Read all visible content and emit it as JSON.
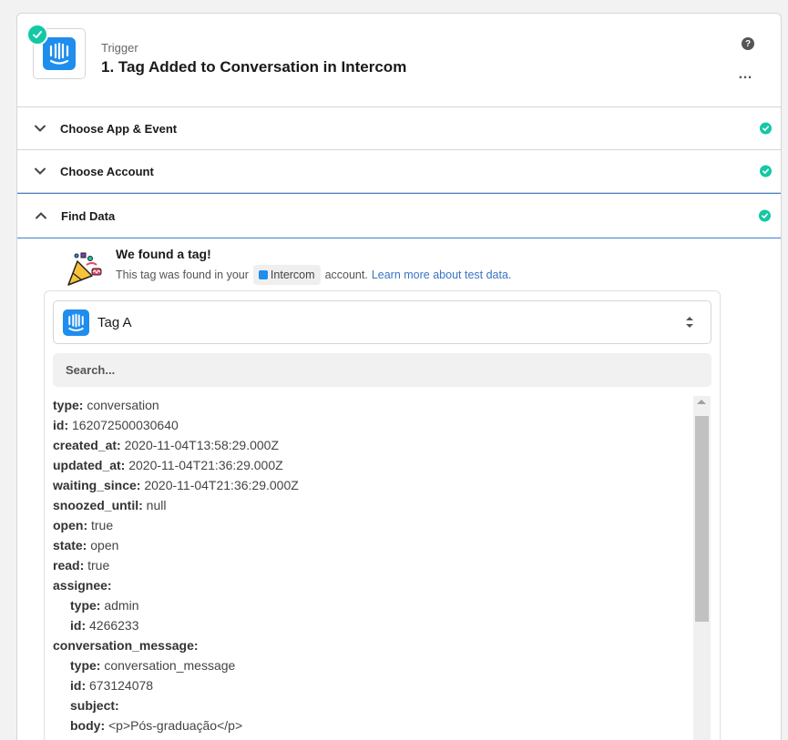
{
  "header": {
    "trigger_label": "Trigger",
    "step_title": "1. Tag Added to Conversation in Intercom",
    "help_symbol": "?",
    "more_symbol": "…"
  },
  "sections": [
    {
      "label": "Choose App & Event",
      "state": "collapsed"
    },
    {
      "label": "Choose Account",
      "state": "collapsed"
    },
    {
      "label": "Find Data",
      "state": "expanded"
    }
  ],
  "found": {
    "title": "We found a tag!",
    "text_before": "This tag was found in your",
    "app_name": "Intercom",
    "text_after": "account.",
    "link": "Learn more about test data."
  },
  "selector": {
    "value": "Tag A"
  },
  "search": {
    "placeholder": "Search..."
  },
  "fields": [
    {
      "key": "type:",
      "value": "conversation",
      "level": 0
    },
    {
      "key": "id:",
      "value": "162072500030640",
      "level": 0
    },
    {
      "key": "created_at:",
      "value": "2020-11-04T13:58:29.000Z",
      "level": 0
    },
    {
      "key": "updated_at:",
      "value": "2020-11-04T21:36:29.000Z",
      "level": 0
    },
    {
      "key": "waiting_since:",
      "value": "2020-11-04T21:36:29.000Z",
      "level": 0
    },
    {
      "key": "snoozed_until:",
      "value": "null",
      "level": 0
    },
    {
      "key": "open:",
      "value": "true",
      "level": 0
    },
    {
      "key": "state:",
      "value": "open",
      "level": 0
    },
    {
      "key": "read:",
      "value": "true",
      "level": 0
    },
    {
      "key": "assignee:",
      "value": "",
      "level": 0
    },
    {
      "key": "type:",
      "value": "admin",
      "level": 1
    },
    {
      "key": "id:",
      "value": "4266233",
      "level": 1
    },
    {
      "key": "conversation_message:",
      "value": "",
      "level": 0
    },
    {
      "key": "type:",
      "value": "conversation_message",
      "level": 1
    },
    {
      "key": "id:",
      "value": "673124078",
      "level": 1
    },
    {
      "key": "subject:",
      "value": "",
      "level": 1
    },
    {
      "key": "body:",
      "value": "<p>Pós-graduação</p>",
      "level": 1
    }
  ],
  "colors": {
    "accent": "#3d7fd6",
    "success": "#13c8a5",
    "intercom": "#1f8ded",
    "link": "#3b73c6"
  }
}
